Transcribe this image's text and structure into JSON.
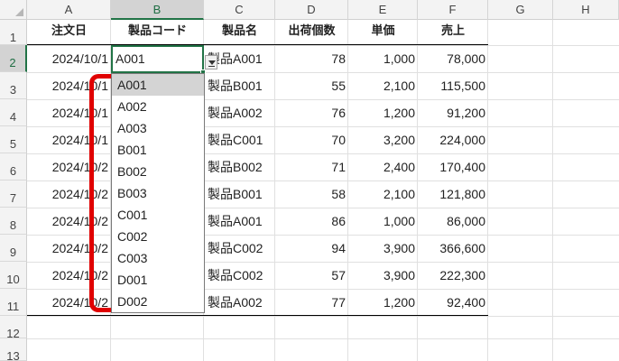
{
  "columns": [
    "A",
    "B",
    "C",
    "D",
    "E",
    "F",
    "G",
    "H"
  ],
  "rows": [
    "1",
    "2",
    "3",
    "4",
    "5",
    "6",
    "7",
    "8",
    "9",
    "10",
    "11",
    "12",
    "13"
  ],
  "active_column": "B",
  "active_row": "2",
  "headers": [
    "注文日",
    "製品コード",
    "製品名",
    "出荷個数",
    "単価",
    "売上"
  ],
  "data_rows": [
    {
      "date": "2024/10/1",
      "code": "A001",
      "name": "製品A001",
      "qty": "78",
      "price": "1,000",
      "sales": "78,000"
    },
    {
      "date": "2024/10/1",
      "code": "",
      "name": "製品B001",
      "qty": "55",
      "price": "2,100",
      "sales": "115,500"
    },
    {
      "date": "2024/10/1",
      "code": "",
      "name": "製品A002",
      "qty": "76",
      "price": "1,200",
      "sales": "91,200"
    },
    {
      "date": "2024/10/1",
      "code": "",
      "name": "製品C001",
      "qty": "70",
      "price": "3,200",
      "sales": "224,000"
    },
    {
      "date": "2024/10/2",
      "code": "",
      "name": "製品B002",
      "qty": "71",
      "price": "2,400",
      "sales": "170,400"
    },
    {
      "date": "2024/10/2",
      "code": "",
      "name": "製品B001",
      "qty": "58",
      "price": "2,100",
      "sales": "121,800"
    },
    {
      "date": "2024/10/2",
      "code": "",
      "name": "製品A001",
      "qty": "86",
      "price": "1,000",
      "sales": "86,000"
    },
    {
      "date": "2024/10/2",
      "code": "",
      "name": "製品C002",
      "qty": "94",
      "price": "3,900",
      "sales": "366,600"
    },
    {
      "date": "2024/10/2",
      "code": "",
      "name": "製品C002",
      "qty": "57",
      "price": "3,900",
      "sales": "222,300"
    },
    {
      "date": "2024/10/2",
      "code": "",
      "name": "製品A002",
      "qty": "77",
      "price": "1,200",
      "sales": "92,400"
    }
  ],
  "active_cell_value": "A001",
  "dropdown": {
    "items": [
      "A001",
      "A002",
      "A003",
      "B001",
      "B002",
      "B003",
      "C001",
      "C002",
      "C003",
      "D001",
      "D002"
    ],
    "selected": "A001",
    "button_icon": "dropdown-arrow-icon"
  },
  "colors": {
    "accent": "#217346",
    "highlight": "#e00000",
    "header_bg": "#f3f3f3",
    "selected_header_bg": "#d3d3d3"
  }
}
